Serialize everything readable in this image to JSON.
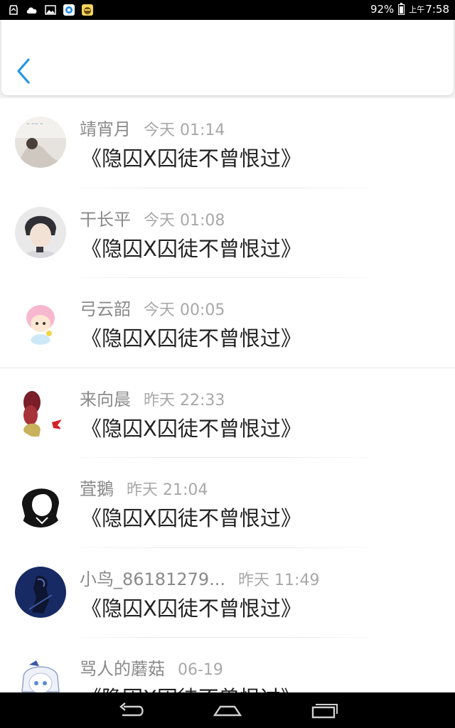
{
  "status_bar": {
    "battery": "92%",
    "ampm": "上午",
    "time": "7:58",
    "icons": [
      "sync-icon",
      "cloud-icon",
      "image-icon",
      "browser-icon",
      "app-icon"
    ]
  },
  "header": {
    "back_icon": "chevron-left-icon"
  },
  "comments": [
    {
      "name": "靖宵月",
      "time": "今天 01:14",
      "text": "《隐囚X囚徒不曾恨过》",
      "avatar": "avatar-1"
    },
    {
      "name": "干长平",
      "time": "今天 01:08",
      "text": "《隐囚X囚徒不曾恨过》",
      "avatar": "avatar-2"
    },
    {
      "name": "弓云韶",
      "time": "今天 00:05",
      "text": "《隐囚X囚徒不曾恨过》",
      "avatar": "avatar-3"
    },
    {
      "name": "来向晨",
      "time": "昨天 22:33",
      "text": "《隐囚X囚徒不曾恨过》",
      "avatar": "avatar-4"
    },
    {
      "name": "萓鵝",
      "time": "昨天 21:04",
      "text": "《隐囚X囚徒不曾恨过》",
      "avatar": "avatar-5"
    },
    {
      "name": "小鸟_86181279...",
      "time": "昨天 11:49",
      "text": "《隐囚X囚徒不曾恨过》",
      "avatar": "avatar-6"
    },
    {
      "name": "骂人的蘑菇",
      "time": "06-19",
      "text": "《隐囚X囚徒不曾恨过》",
      "avatar": "avatar-7"
    }
  ],
  "nav_bar": {
    "icons": [
      "back-nav-icon",
      "home-nav-icon",
      "recents-nav-icon"
    ]
  },
  "colors": {
    "accent": "#2196e6",
    "name": "#8a8a8a",
    "time": "#a8a8a8",
    "text": "#222222"
  }
}
